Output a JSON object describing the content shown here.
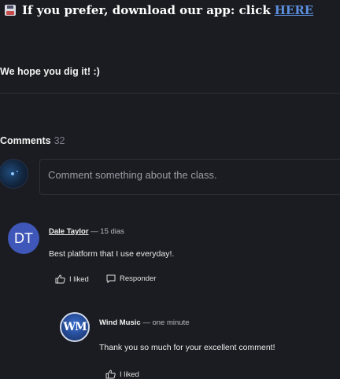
{
  "banner": {
    "text": "If you prefer, download our app: click",
    "link_label": "HERE",
    "icon": "floppy-disk-icon"
  },
  "intro_text": "We hope you dig it! :)",
  "comments_section": {
    "title": "Comments",
    "count": "32",
    "input_placeholder": "Comment something about the class."
  },
  "comments": [
    {
      "avatar_initials": "DT",
      "avatar_color": "#3f57b8",
      "author": "Dale Taylor",
      "time": "— 15 dias",
      "text": "Best platform that I use everyday!.",
      "like_label": "I liked",
      "reply_label": "Responder"
    }
  ],
  "reply": {
    "avatar_initials": "WM",
    "author": "Wind Music",
    "time": "— one minute",
    "text": "Thank you so much for your excellent comment!",
    "like_label": "I liked"
  },
  "colors": {
    "background": "#1b1c21",
    "link": "#5c8fe0",
    "muted": "#7b7e88"
  }
}
